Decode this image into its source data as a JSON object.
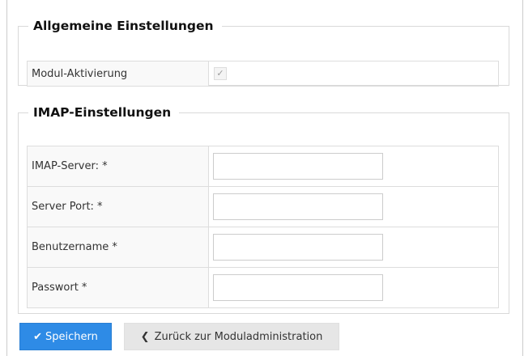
{
  "sections": {
    "general": {
      "title": "Allgemeine Einstellungen",
      "rows": [
        {
          "label": "Modul-Aktivierung",
          "checked": true
        }
      ]
    },
    "imap": {
      "title": "IMAP-Einstellungen",
      "rows": [
        {
          "label": "IMAP-Server: *",
          "value": ""
        },
        {
          "label": "Server Port: *",
          "value": ""
        },
        {
          "label": "Benutzername *",
          "value": ""
        },
        {
          "label": "Passwort *",
          "value": ""
        }
      ]
    }
  },
  "buttons": {
    "save_label": "Speichern",
    "save_icon": "check-icon",
    "back_label": "Zurück zur Moduladministration",
    "back_icon": "chevron-left-icon"
  },
  "colors": {
    "primary": "#2e8be6",
    "secondary": "#e6e6e6"
  }
}
